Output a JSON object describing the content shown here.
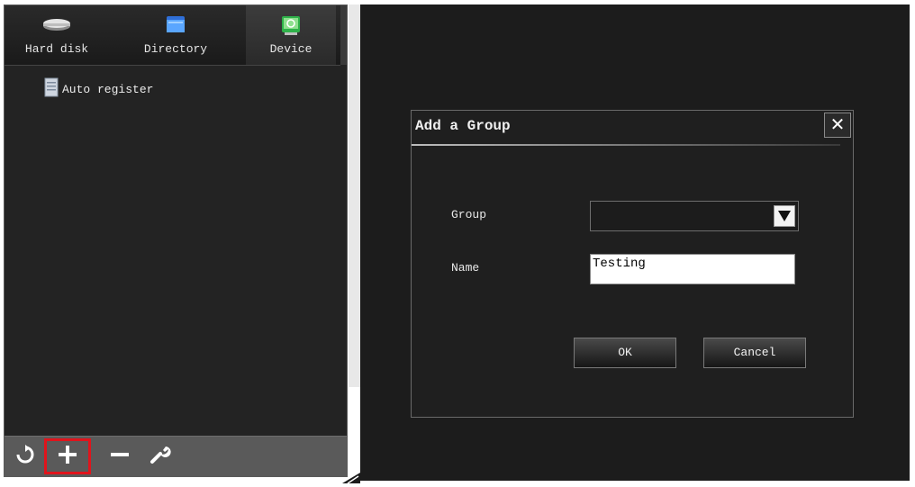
{
  "tabs": [
    {
      "label": "Hard disk",
      "icon": "hard-disk-icon"
    },
    {
      "label": "Directory",
      "icon": "folder-icon"
    },
    {
      "label": "Device",
      "icon": "device-icon",
      "active": true
    }
  ],
  "tree": {
    "items": [
      {
        "label": "Auto register",
        "icon": "document-icon"
      }
    ]
  },
  "toolbar": {
    "buttons": [
      "refresh-icon",
      "add-icon",
      "remove-icon",
      "wrench-icon"
    ],
    "highlight_color": "#e0141c"
  },
  "dialog": {
    "title": "Add a Group",
    "group_label": "Group",
    "group_value": "",
    "name_label": "Name",
    "name_value": "Testing",
    "ok_label": "OK",
    "cancel_label": "Cancel",
    "close_glyph": "✕"
  }
}
